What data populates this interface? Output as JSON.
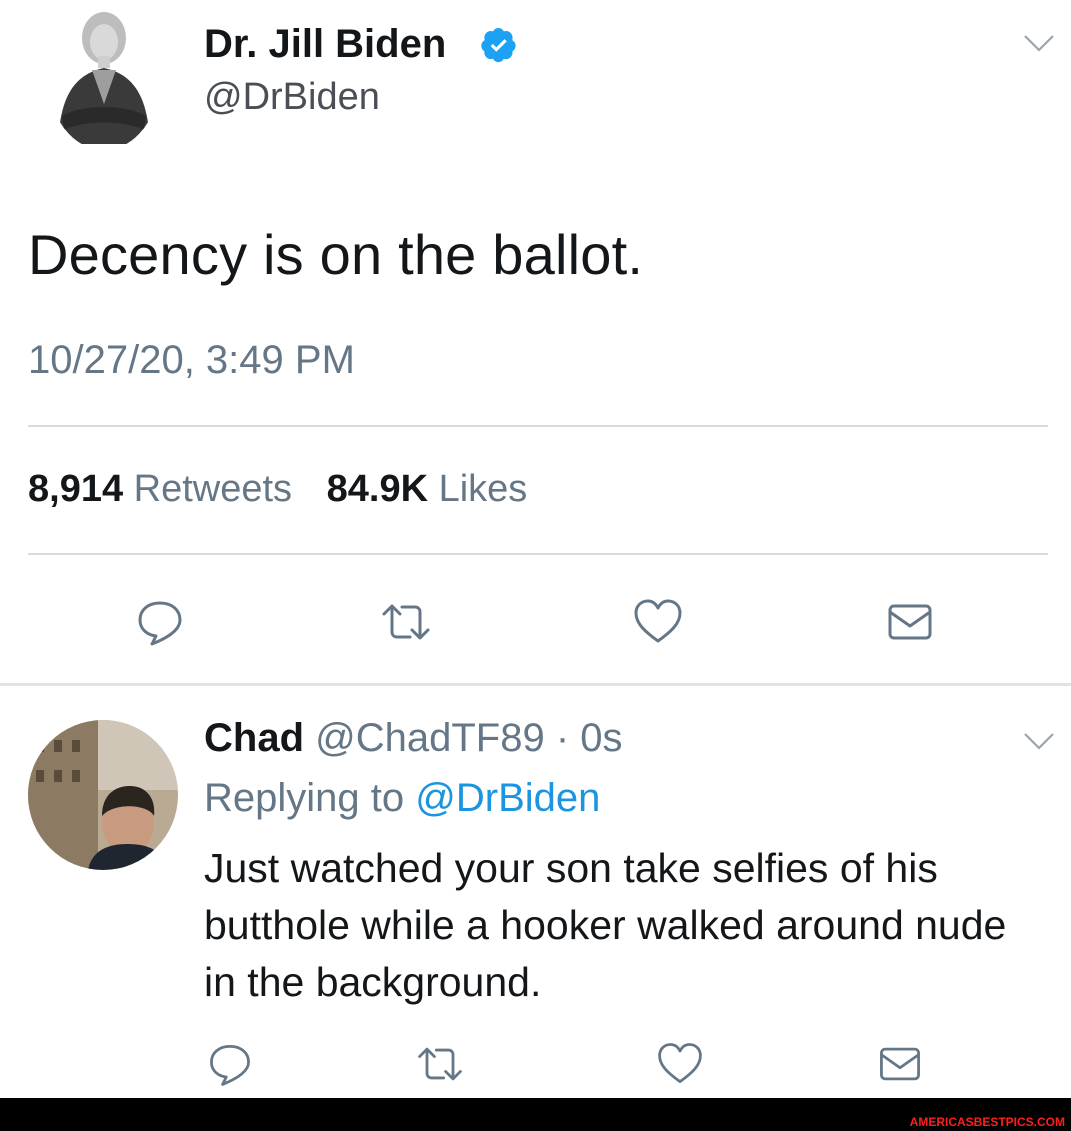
{
  "main_tweet": {
    "display_name": "Dr. Jill Biden",
    "handle": "@DrBiden",
    "text": "Decency is on the ballot.",
    "timestamp": "10/27/20, 3:49 PM",
    "retweets_count": "8,914",
    "retweets_label": "Retweets",
    "likes_count": "84.9K",
    "likes_label": "Likes"
  },
  "reply_tweet": {
    "display_name": "Chad",
    "handle_time": "@ChadTF89 · 0s",
    "replying_prefix": "Replying to",
    "replying_to": "@DrBiden",
    "text": "Just watched your son take selfies of his butthole while a hooker walked around nude in the background."
  },
  "icons": {
    "verified": "verified-badge-icon",
    "chevron": "chevron-down-icon",
    "reply": "reply-icon",
    "retweet": "retweet-icon",
    "like": "heart-icon",
    "dm": "envelope-icon"
  },
  "colors": {
    "verified_blue": "#1da1f2",
    "link_blue": "#1b95e0",
    "secondary_text": "#657786",
    "icon_gray": "#657786"
  },
  "watermark": "AMERICASBESTPICS.COM"
}
